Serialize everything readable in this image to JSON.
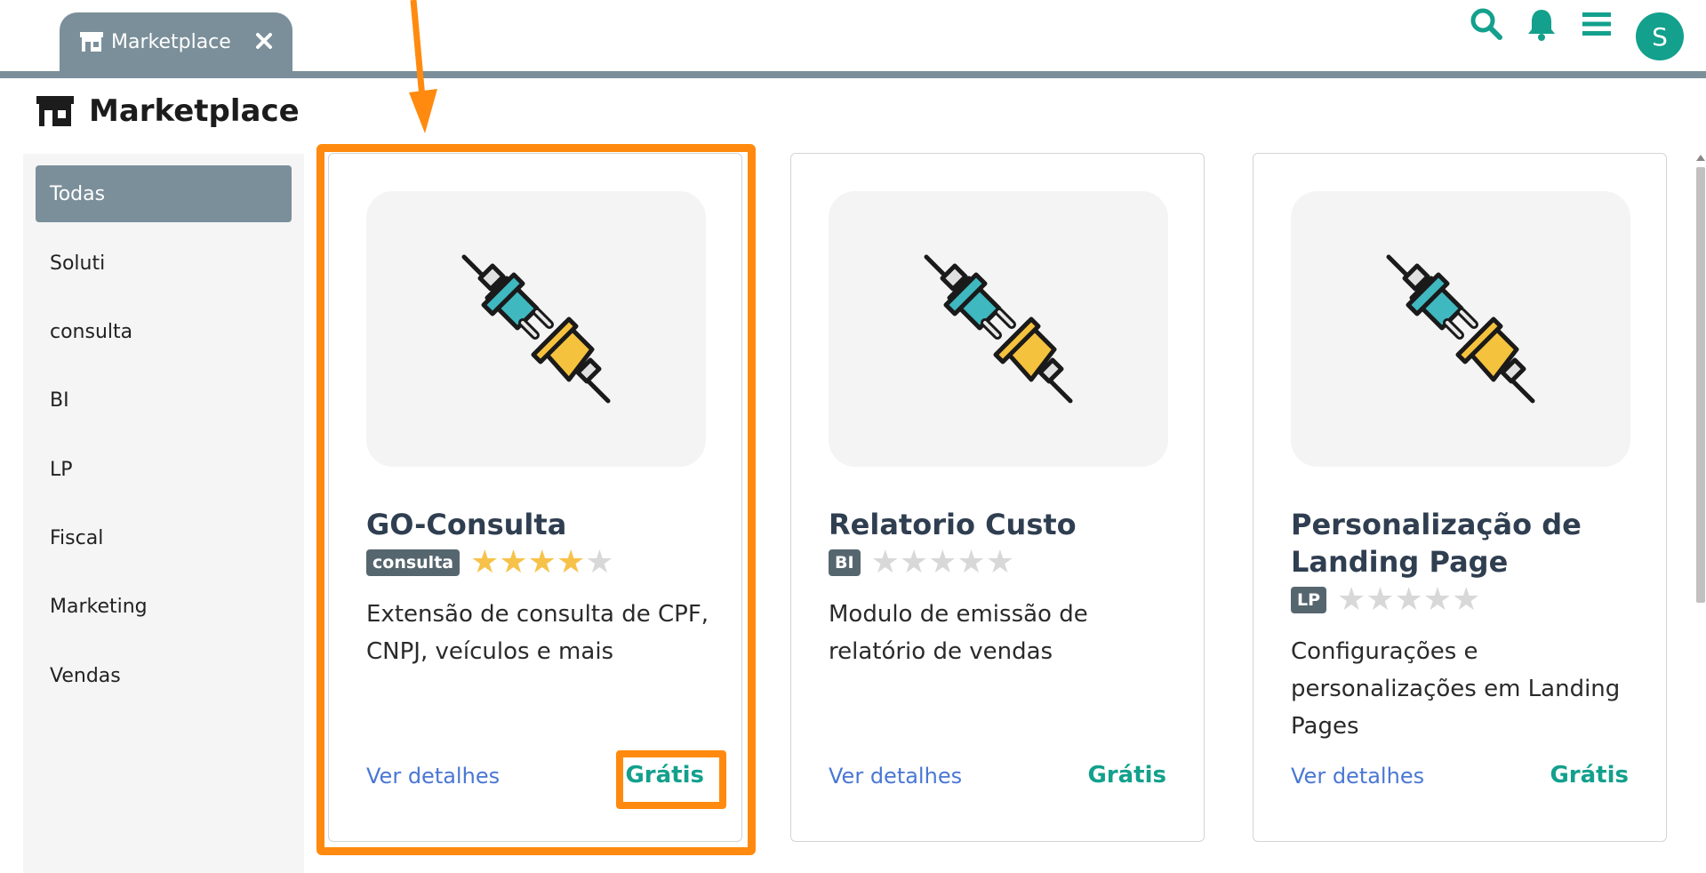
{
  "tab": {
    "label": "Marketplace"
  },
  "header": {
    "title": "Marketplace",
    "avatar_initial": "S"
  },
  "sidebar": {
    "items": [
      {
        "label": "Todas",
        "active": true
      },
      {
        "label": "Soluti"
      },
      {
        "label": "consulta"
      },
      {
        "label": "BI"
      },
      {
        "label": "LP"
      },
      {
        "label": "Fiscal"
      },
      {
        "label": "Marketing"
      },
      {
        "label": "Vendas"
      }
    ]
  },
  "cards": [
    {
      "title": "GO-Consulta",
      "badge": "consulta",
      "rating": 4,
      "description": "Extensão de consulta de CPF, CNPJ, veículos e mais",
      "link": "Ver detalhes",
      "price": "Grátis"
    },
    {
      "title": "Relatorio Custo",
      "badge": "BI",
      "rating": 0,
      "description": "Modulo de emissão de relatório de vendas",
      "link": "Ver detalhes",
      "price": "Grátis"
    },
    {
      "title": "Personalização de Landing Page",
      "badge": "LP",
      "rating": 0,
      "description": "Configurações e personalizações em Landing Pages",
      "link": "Ver detalhes",
      "price": "Grátis"
    }
  ],
  "colors": {
    "accent": "#13a08c",
    "tab_bg": "#7b8f9a",
    "highlight": "#ff8a0f",
    "star_on": "#f7c24a",
    "star_off": "#d8d8d8"
  },
  "icons": [
    "store-icon",
    "close-icon",
    "search-icon",
    "bell-icon",
    "menu-icon",
    "plug-icon",
    "star-icon"
  ]
}
